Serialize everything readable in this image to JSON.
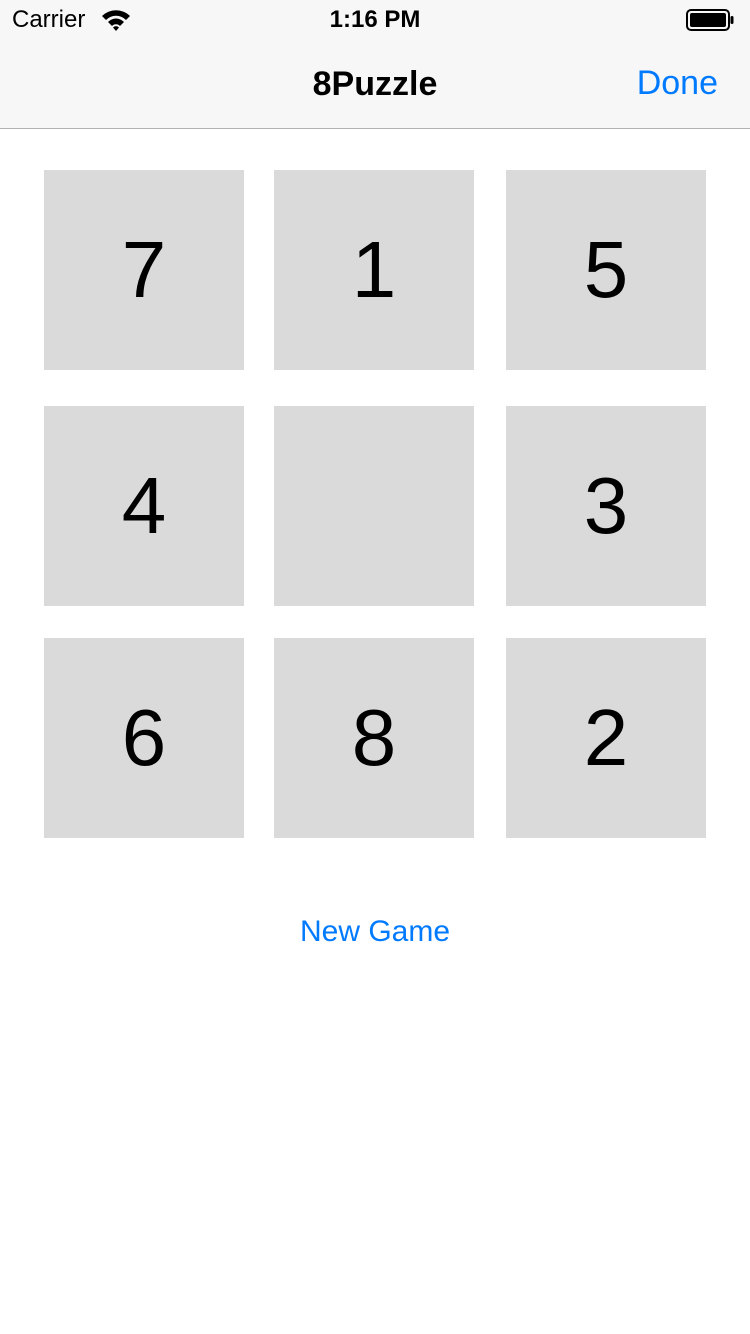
{
  "status_bar": {
    "carrier": "Carrier",
    "time": "1:16 PM",
    "wifi_icon": "wifi-icon",
    "battery_icon": "battery-icon"
  },
  "nav": {
    "title": "8Puzzle",
    "done_label": "Done"
  },
  "board": {
    "tiles": [
      "7",
      "1",
      "5",
      "4",
      "",
      "3",
      "6",
      "8",
      "2"
    ]
  },
  "new_game_label": "New Game",
  "colors": {
    "accent": "#007aff",
    "tile": "#dadada",
    "bar_background": "#f7f7f7"
  }
}
